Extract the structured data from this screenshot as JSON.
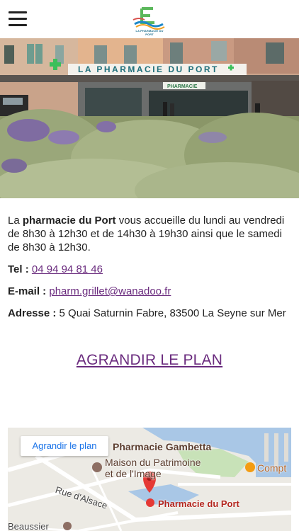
{
  "header": {
    "menu_icon": "hamburger-menu-icon",
    "logo_text": "LA PHARMACIE DU PORT"
  },
  "hero": {
    "sign_text": "LA PHARMACIE DU PORT",
    "sign_small": "PHARMACIE"
  },
  "intro": {
    "prefix": "La ",
    "name": "pharmacie du Port",
    "rest": " vous accueille du lundi au vendredi de 8h30 à 12h30 et de 14h30 à 19h30 ainsi que le samedi de 8h30 à 12h30."
  },
  "contact": {
    "tel_label": "Tel : ",
    "tel_value": "04 94 94 81 46",
    "email_label": "E-mail : ",
    "email_value": "pharm.grillet@wanadoo.fr",
    "address_label": "Adresse : ",
    "address_value": "5 Quai Saturnin Fabre, 83500 La Seyne sur Mer"
  },
  "plan_link_label": "AGRANDIR LE PLAN",
  "map": {
    "button_label": "Agrandir le plan",
    "labels": {
      "gambetta": "Pharmacie Gambetta",
      "maison_1": "Maison du Patrimoine",
      "maison_2": "et de l'Image",
      "compt": "Compt",
      "rue_alsace": "Rue d'Alsace",
      "pharmacie_port": "Pharmacie du Port",
      "beaussier": "Beaussier"
    },
    "colors": {
      "land": "#e8e6e1",
      "water": "#a9c7e6",
      "park": "#c8e2b8",
      "pin": "#e53935"
    }
  }
}
